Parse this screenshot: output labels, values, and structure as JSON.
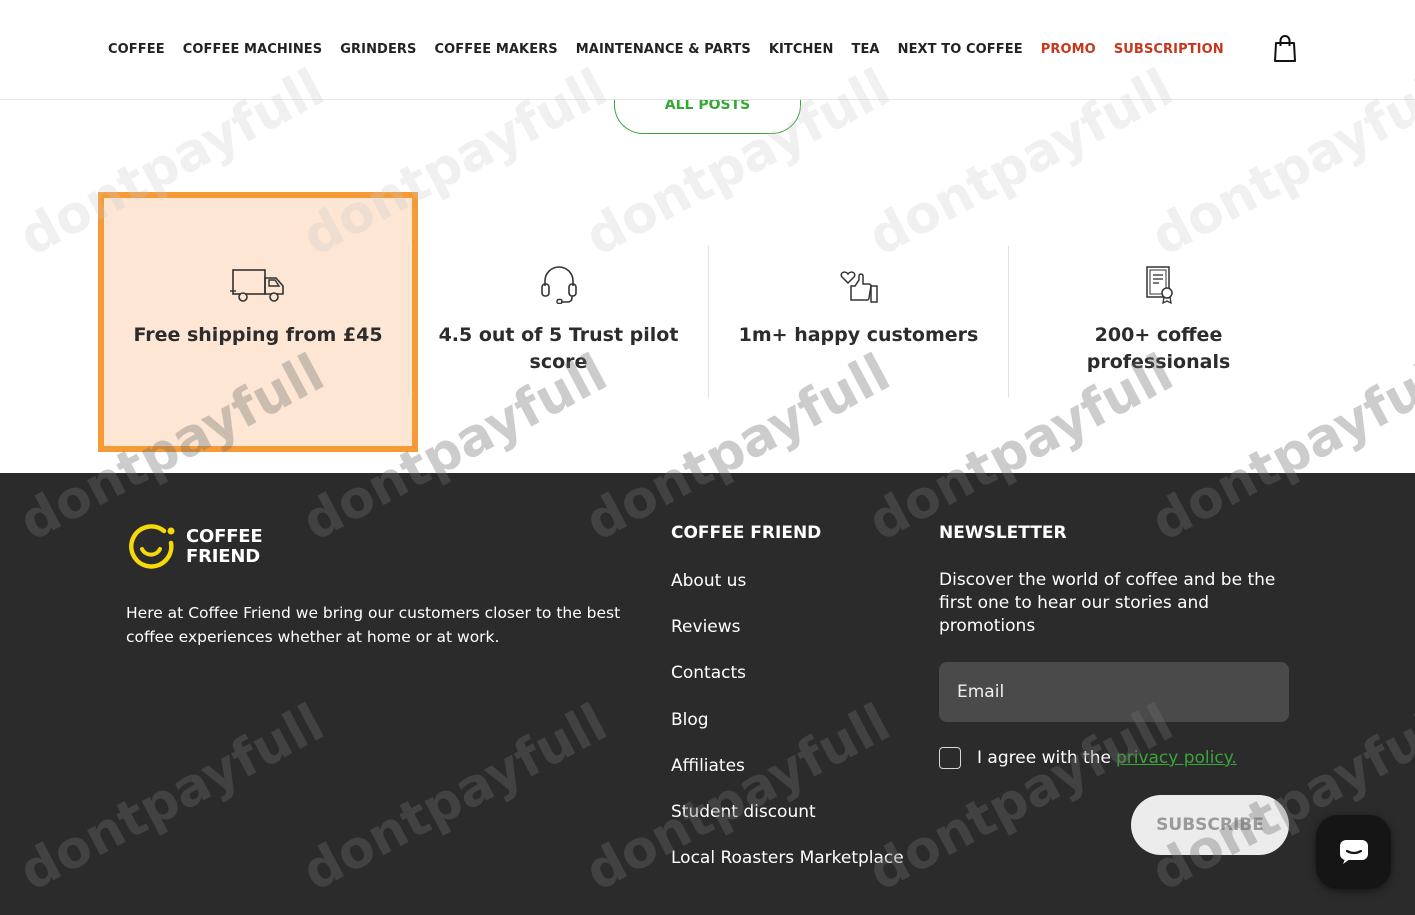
{
  "nav": {
    "items": [
      {
        "label": "COFFEE",
        "promo": false
      },
      {
        "label": "COFFEE MACHINES",
        "promo": false
      },
      {
        "label": "GRINDERS",
        "promo": false
      },
      {
        "label": "COFFEE MAKERS",
        "promo": false
      },
      {
        "label": "MAINTENANCE & PARTS",
        "promo": false
      },
      {
        "label": "KITCHEN",
        "promo": false
      },
      {
        "label": "TEA",
        "promo": false
      },
      {
        "label": "NEXT TO COFFEE",
        "promo": false
      },
      {
        "label": "PROMO",
        "promo": true
      },
      {
        "label": "SUBSCRIPTION",
        "promo": true
      }
    ],
    "cart_icon": "shopping-bag-icon"
  },
  "all_posts_label": "ALL POSTS",
  "features": [
    {
      "icon": "truck-icon",
      "text": "Free shipping from £45"
    },
    {
      "icon": "headset-icon",
      "text": "4.5 out of 5 Trust pilot score"
    },
    {
      "icon": "thumbs-up-heart-icon",
      "text": "1m+ happy customers"
    },
    {
      "icon": "certificate-icon",
      "text": "200+ coffee professionals"
    }
  ],
  "footer": {
    "logo_text": "COFFEE FRIEND",
    "about": "Here at Coffee Friend we bring our customers closer to the best coffee experiences whether at home or at work.",
    "links_title": "COFFEE FRIEND",
    "links": [
      "About us",
      "Reviews",
      "Contacts",
      "Blog",
      "Affiliates",
      "Student discount",
      "Local Roasters Marketplace"
    ],
    "newsletter": {
      "title": "NEWSLETTER",
      "description": "Discover the world of coffee and be the first one to hear our stories and promotions",
      "email_placeholder": "Email",
      "agree_text": "I agree with the",
      "privacy_link": "privacy policy.",
      "subscribe_label": "SUBSCRIBE"
    }
  },
  "watermark": "dontpayfull",
  "colors": {
    "accent_green": "#3aa53a",
    "promo_red": "#c7371c",
    "highlight_orange": "#f59a35",
    "footer_bg": "#2b2b2b",
    "logo_yellow": "#f5d90a"
  }
}
